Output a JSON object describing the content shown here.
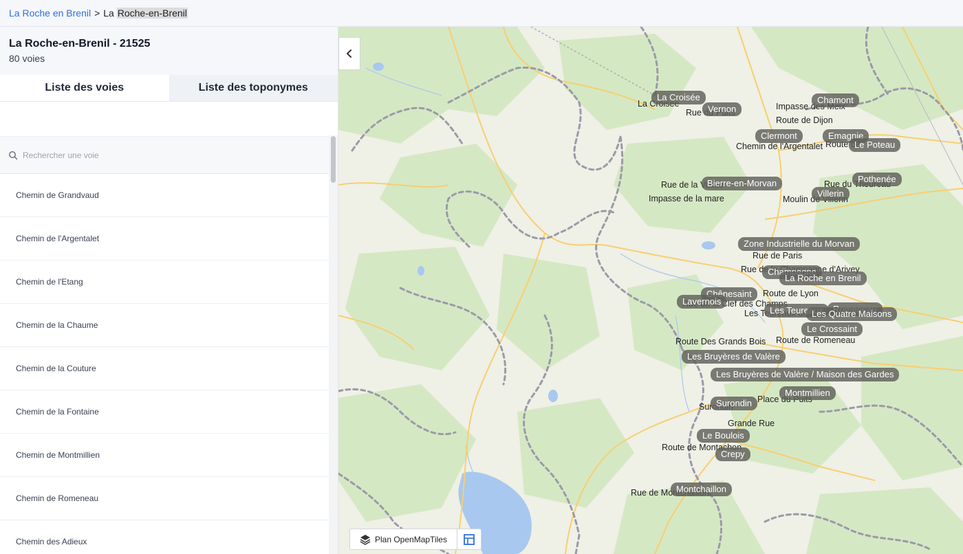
{
  "breadcrumb": {
    "link": "La Roche en Brenil",
    "separator": ">",
    "current_prefix": "La ",
    "current_highlight": "Roche-en-Brenil"
  },
  "commune": {
    "title": "La Roche-en-Brenil - 21525",
    "count": "80 voies"
  },
  "tabs": [
    "Liste des voies",
    "Liste des toponymes"
  ],
  "search": {
    "placeholder": "Rechercher une voie"
  },
  "voies": [
    "Chemin de Grandvaud",
    "Chemin de l'Argentalet",
    "Chemin de l'Etang",
    "Chemin de la Chaume",
    "Chemin de la Couture",
    "Chemin de la Fontaine",
    "Chemin de Montmillien",
    "Chemin de Romeneau",
    "Chemin des Adieux"
  ],
  "map": {
    "collapse_icon": "chevron-left-icon",
    "style_label": "Plan OpenMapTiles",
    "toponyms": [
      "La Croisée",
      "Vernon",
      "Chamont",
      "Clermont",
      "Emagnie",
      "Le Poteau",
      "Bierre-en-Morvan",
      "Villerin",
      "Pothenée",
      "Zone Industrielle du Morvan",
      "Champagne",
      "La Roche en Brenil",
      "Chênesaint",
      "Lavernois",
      "Les Teureaux",
      "Romeneau",
      "Les Quatre Maisons",
      "Le Crossaint",
      "Les Bruyères de Valère",
      "Les Bruyères de Valère / Maison des Gardes",
      "Montmillien",
      "Surondin",
      "Le Boulois",
      "Crepy",
      "Montchaillon"
    ],
    "streets": [
      "La Croisée",
      "Rue du Puits",
      "Impasse des Meix",
      "Route de Dijon",
      "Chemin de l'Argentalet",
      "Route de",
      "Rue de la Vallée",
      "Rue du Theureau",
      "Impasse de la mare",
      "Moulin de Villerin",
      "Rue de Paris",
      "Rue de la Champagne d'Arivey",
      "Route de Lyon",
      "Rue de la Clef des Champs",
      "Les Teureaux de Mâche",
      "Route de Romeneau",
      "Route Des Grands Bois",
      "Place du Puits",
      "Surondin",
      "Grande Rue",
      "Route de Montachon",
      "Rue de Montchaillon"
    ],
    "colors": {
      "forest": "#d5e8c4",
      "land": "#eff0e6",
      "road": "#f7cf6f",
      "water": "#a8c8ef",
      "boundary": "#9a9aa8"
    }
  }
}
